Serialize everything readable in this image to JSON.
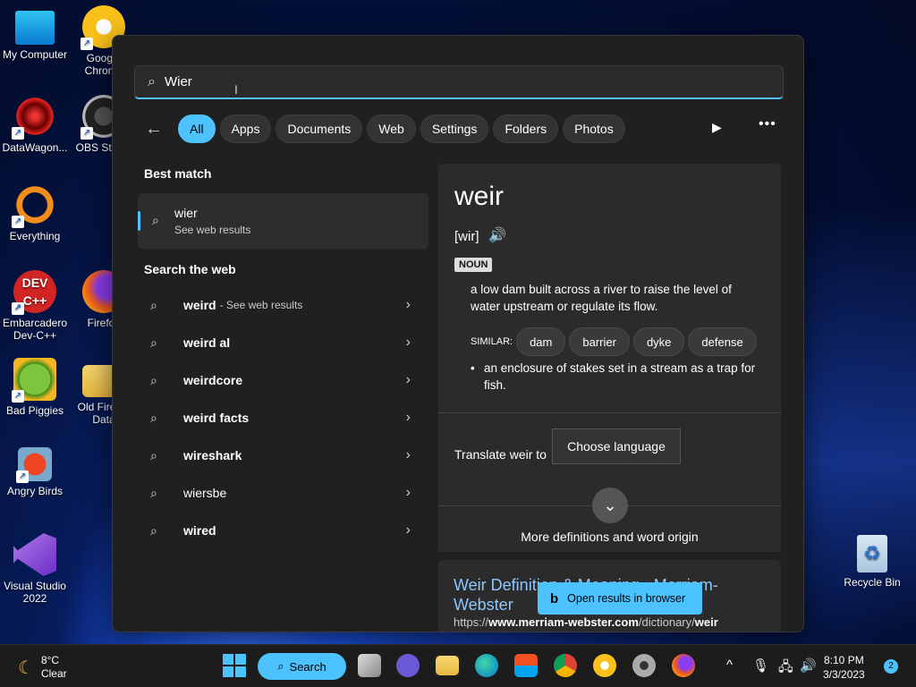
{
  "desktop": {
    "icons": [
      {
        "label": "My Computer"
      },
      {
        "label": "Google Chrome"
      },
      {
        "label": "DataWagon..."
      },
      {
        "label": "OBS Studio"
      },
      {
        "label": "Everything"
      },
      {
        "label": "Embarcadero Dev-C++"
      },
      {
        "label": "Firefox"
      },
      {
        "label": "Bad Piggies"
      },
      {
        "label": "Old Firefox Data"
      },
      {
        "label": "Angry Birds"
      },
      {
        "label": "Visual Studio 2022"
      },
      {
        "label": "Recycle Bin"
      }
    ]
  },
  "search": {
    "query": "Wier",
    "filters": [
      "All",
      "Apps",
      "Documents",
      "Web",
      "Settings",
      "Folders",
      "Photos"
    ],
    "active_filter": "All",
    "best_match_title": "Best match",
    "best_match": {
      "title": "wier",
      "subtitle": "See web results"
    },
    "web_title": "Search the web",
    "web_items": [
      {
        "label": "weird",
        "sub": "- See web results"
      },
      {
        "label": "weird al",
        "sub": ""
      },
      {
        "label": "weirdcore",
        "sub": ""
      },
      {
        "label": "weird facts",
        "sub": ""
      },
      {
        "label": "wireshark",
        "sub": ""
      },
      {
        "label": "wiersbe",
        "sub": ""
      },
      {
        "label": "wired",
        "sub": ""
      }
    ]
  },
  "definition": {
    "word": "weir",
    "pronunciation": "[wir]",
    "pos": "NOUN",
    "def1": "a low dam built across a river to raise the level of water upstream or regulate its flow.",
    "similar_label": "SIMILAR:",
    "similar": [
      "dam",
      "barrier",
      "dyke",
      "defense"
    ],
    "def2": "an enclosure of stakes set in a stream as a trap for fish.",
    "translate_label": "Translate weir to",
    "translate_button": "Choose language",
    "more": "More definitions and word origin"
  },
  "result": {
    "title": "Weir Definition & Meaning - Merriam-Webster",
    "url_prefix": "https://",
    "url_domain": "www.merriam-webster.com",
    "url_path": "/dictionary/",
    "url_word": "weir"
  },
  "open_browser": "Open results in browser",
  "taskbar": {
    "temp": "8°C",
    "condition": "Clear",
    "search_label": "Search",
    "time": "8:10 PM",
    "date": "3/3/2023",
    "notifications": "2"
  },
  "colors": {
    "accent": "#4cc2ff",
    "panel": "#202020",
    "card": "#2b2b2b"
  }
}
